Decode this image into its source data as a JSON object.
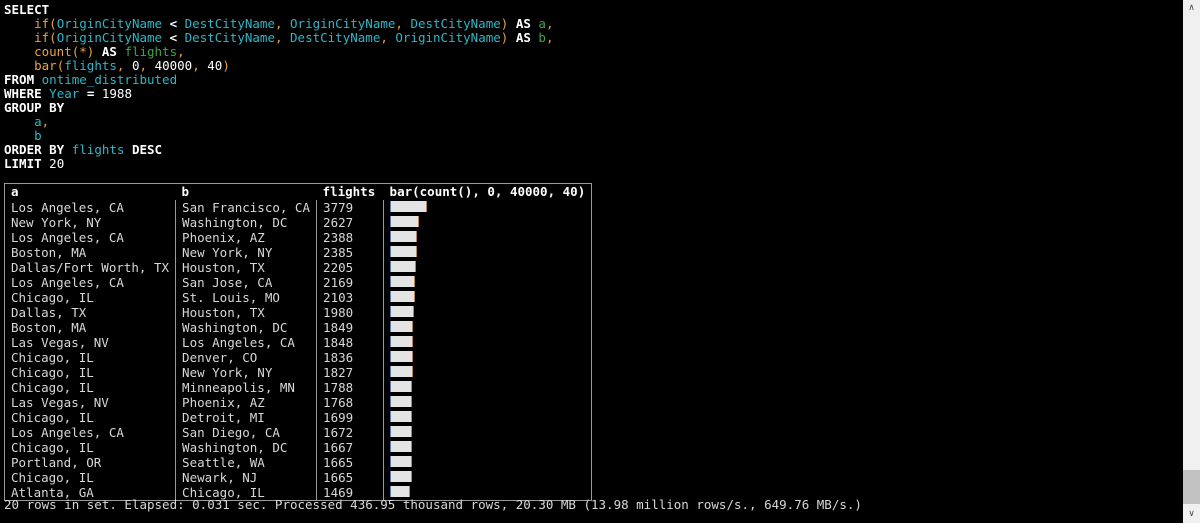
{
  "query": {
    "lines": [
      [
        {
          "t": "SELECT",
          "c": "kw"
        }
      ],
      [
        {
          "t": "    ",
          "c": "plain"
        },
        {
          "t": "if",
          "c": "fn"
        },
        {
          "t": "(",
          "c": "punc"
        },
        {
          "t": "OriginCityName",
          "c": "ident"
        },
        {
          "t": " ",
          "c": "plain"
        },
        {
          "t": "<",
          "c": "op"
        },
        {
          "t": " ",
          "c": "plain"
        },
        {
          "t": "DestCityName",
          "c": "ident"
        },
        {
          "t": ",",
          "c": "punc"
        },
        {
          "t": " ",
          "c": "plain"
        },
        {
          "t": "OriginCityName",
          "c": "ident"
        },
        {
          "t": ",",
          "c": "punc"
        },
        {
          "t": " ",
          "c": "plain"
        },
        {
          "t": "DestCityName",
          "c": "ident"
        },
        {
          "t": ")",
          "c": "punc"
        },
        {
          "t": " ",
          "c": "plain"
        },
        {
          "t": "AS",
          "c": "kw"
        },
        {
          "t": " ",
          "c": "plain"
        },
        {
          "t": "a",
          "c": "alias"
        },
        {
          "t": ",",
          "c": "punc"
        }
      ],
      [
        {
          "t": "    ",
          "c": "plain"
        },
        {
          "t": "if",
          "c": "fn"
        },
        {
          "t": "(",
          "c": "punc"
        },
        {
          "t": "OriginCityName",
          "c": "ident"
        },
        {
          "t": " ",
          "c": "plain"
        },
        {
          "t": "<",
          "c": "op"
        },
        {
          "t": " ",
          "c": "plain"
        },
        {
          "t": "DestCityName",
          "c": "ident"
        },
        {
          "t": ",",
          "c": "punc"
        },
        {
          "t": " ",
          "c": "plain"
        },
        {
          "t": "DestCityName",
          "c": "ident"
        },
        {
          "t": ",",
          "c": "punc"
        },
        {
          "t": " ",
          "c": "plain"
        },
        {
          "t": "OriginCityName",
          "c": "ident"
        },
        {
          "t": ")",
          "c": "punc"
        },
        {
          "t": " ",
          "c": "plain"
        },
        {
          "t": "AS",
          "c": "kw"
        },
        {
          "t": " ",
          "c": "plain"
        },
        {
          "t": "b",
          "c": "alias"
        },
        {
          "t": ",",
          "c": "punc"
        }
      ],
      [
        {
          "t": "    ",
          "c": "plain"
        },
        {
          "t": "count",
          "c": "fn"
        },
        {
          "t": "(*)",
          "c": "punc"
        },
        {
          "t": " ",
          "c": "plain"
        },
        {
          "t": "AS",
          "c": "kw"
        },
        {
          "t": " ",
          "c": "plain"
        },
        {
          "t": "flights",
          "c": "alias"
        },
        {
          "t": ",",
          "c": "punc"
        }
      ],
      [
        {
          "t": "    ",
          "c": "plain"
        },
        {
          "t": "bar",
          "c": "fn"
        },
        {
          "t": "(",
          "c": "punc"
        },
        {
          "t": "flights",
          "c": "ident"
        },
        {
          "t": ",",
          "c": "punc"
        },
        {
          "t": " ",
          "c": "plain"
        },
        {
          "t": "0",
          "c": "num"
        },
        {
          "t": ",",
          "c": "punc"
        },
        {
          "t": " ",
          "c": "plain"
        },
        {
          "t": "40000",
          "c": "num"
        },
        {
          "t": ",",
          "c": "punc"
        },
        {
          "t": " ",
          "c": "plain"
        },
        {
          "t": "40",
          "c": "num"
        },
        {
          "t": ")",
          "c": "punc"
        }
      ],
      [
        {
          "t": "FROM",
          "c": "kw"
        },
        {
          "t": " ",
          "c": "plain"
        },
        {
          "t": "ontime_distributed",
          "c": "ident"
        }
      ],
      [
        {
          "t": "WHERE",
          "c": "kw"
        },
        {
          "t": " ",
          "c": "plain"
        },
        {
          "t": "Year",
          "c": "ident"
        },
        {
          "t": " ",
          "c": "plain"
        },
        {
          "t": "=",
          "c": "op"
        },
        {
          "t": " ",
          "c": "plain"
        },
        {
          "t": "1988",
          "c": "num"
        }
      ],
      [
        {
          "t": "GROUP BY",
          "c": "kw"
        }
      ],
      [
        {
          "t": "    ",
          "c": "plain"
        },
        {
          "t": "a",
          "c": "ident"
        },
        {
          "t": ",",
          "c": "punc"
        }
      ],
      [
        {
          "t": "    ",
          "c": "plain"
        },
        {
          "t": "b",
          "c": "ident"
        }
      ],
      [
        {
          "t": "ORDER BY",
          "c": "kw"
        },
        {
          "t": " ",
          "c": "plain"
        },
        {
          "t": "flights",
          "c": "ident"
        },
        {
          "t": " ",
          "c": "plain"
        },
        {
          "t": "DESC",
          "c": "kw"
        }
      ],
      [
        {
          "t": "LIMIT",
          "c": "kw"
        },
        {
          "t": " ",
          "c": "plain"
        },
        {
          "t": "20",
          "c": "num"
        }
      ]
    ]
  },
  "result_table": {
    "columns": [
      "a",
      "b",
      "flights",
      "bar(count(), 0, 40000, 40)"
    ],
    "bar_max": 40000,
    "bar_width_chars": 40,
    "rows": [
      {
        "a": "Los Angeles, CA",
        "b": "San Francisco, CA",
        "flights": 3779
      },
      {
        "a": "New York, NY",
        "b": "Washington, DC",
        "flights": 2627
      },
      {
        "a": "Los Angeles, CA",
        "b": "Phoenix, AZ",
        "flights": 2388
      },
      {
        "a": "Boston, MA",
        "b": "New York, NY",
        "flights": 2385
      },
      {
        "a": "Dallas/Fort Worth, TX",
        "b": "Houston, TX",
        "flights": 2205
      },
      {
        "a": "Los Angeles, CA",
        "b": "San Jose, CA",
        "flights": 2169
      },
      {
        "a": "Chicago, IL",
        "b": "St. Louis, MO",
        "flights": 2103
      },
      {
        "a": "Dallas, TX",
        "b": "Houston, TX",
        "flights": 1980
      },
      {
        "a": "Boston, MA",
        "b": "Washington, DC",
        "flights": 1849
      },
      {
        "a": "Las Vegas, NV",
        "b": "Los Angeles, CA",
        "flights": 1848
      },
      {
        "a": "Chicago, IL",
        "b": "Denver, CO",
        "flights": 1836
      },
      {
        "a": "Chicago, IL",
        "b": "New York, NY",
        "flights": 1827
      },
      {
        "a": "Chicago, IL",
        "b": "Minneapolis, MN",
        "flights": 1788
      },
      {
        "a": "Las Vegas, NV",
        "b": "Phoenix, AZ",
        "flights": 1768
      },
      {
        "a": "Chicago, IL",
        "b": "Detroit, MI",
        "flights": 1699
      },
      {
        "a": "Los Angeles, CA",
        "b": "San Diego, CA",
        "flights": 1672
      },
      {
        "a": "Chicago, IL",
        "b": "Washington, DC",
        "flights": 1667
      },
      {
        "a": "Portland, OR",
        "b": "Seattle, WA",
        "flights": 1665
      },
      {
        "a": "Chicago, IL",
        "b": "Newark, NJ",
        "flights": 1665
      },
      {
        "a": "Atlanta, GA",
        "b": "Chicago, IL",
        "flights": 1469
      }
    ]
  },
  "status": {
    "text": "20 rows in set. Elapsed: 0.031 sec. Processed 436.95 thousand rows, 20.30 MB (13.98 million rows/s., 649.76 MB/s.)",
    "rows_in_set": 20,
    "elapsed_sec": "0.031",
    "processed_rows": "436.95 thousand",
    "processed_bytes": "20.30 MB",
    "rows_per_sec": "13.98 million",
    "bytes_per_sec": "649.76 MB/s."
  },
  "scrollbar": {
    "up_arrow": "∧",
    "down_arrow": "∨"
  },
  "colors": {
    "background": "#000000",
    "text": "#d8d8d8",
    "keyword": "#ffffff",
    "function": "#e8a33d",
    "identifier": "#29b8c8",
    "alias": "#3fa648",
    "border": "#9a9a9a",
    "bar_fill": "#e4e4e4",
    "bar_edge": "#b9864b",
    "scrollbar_track": "#f0f0f0",
    "scrollbar_thumb": "#c2c2c2"
  }
}
